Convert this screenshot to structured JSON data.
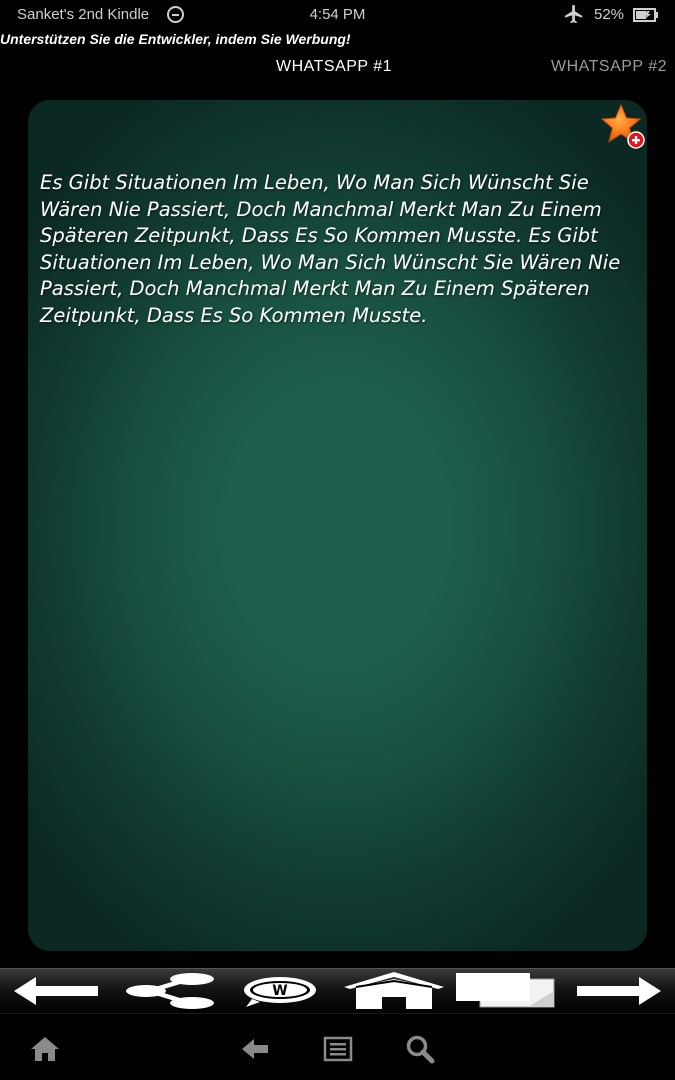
{
  "status_bar": {
    "device_name": "Sanket's 2nd Kindle",
    "time": "4:54 PM",
    "battery": "52%",
    "icons": [
      "do-not-disturb-icon",
      "airplane-icon",
      "battery-icon"
    ]
  },
  "ad_text": "Unterstützen Sie die Entwickler, indem Sie Werbung!",
  "tabs": [
    {
      "label": "WHATSAPP  #1",
      "active": true
    },
    {
      "label": "WHATSAPP  #2",
      "active": false
    }
  ],
  "quote": {
    "text": "Es Gibt Situationen Im Leben, Wo Man Sich Wünscht Sie Wären Nie Passiert, Doch Manchmal Merkt Man Zu Einem Späteren Zeitpunkt, Dass Es So Kommen Musste. Es Gibt Situationen Im Leben, Wo Man Sich Wünscht Sie Wären Nie Passiert, Doch Manchmal Merkt Man Zu Einem Späteren Zeitpunkt, Dass Es So Kommen Musste."
  },
  "card": {
    "favorite_icon": "star-add-icon",
    "colors": {
      "center": "#1d5e4e",
      "edge": "#0b2822",
      "star": "#ff7a1a",
      "badge": "#e0161b"
    }
  },
  "action_bar": {
    "icons": [
      "arrow-left-icon",
      "share-icon",
      "whatsapp-icon",
      "home-icon",
      "copy-icon",
      "arrow-right-icon"
    ]
  },
  "nav_bar": {
    "icons": [
      "home-icon",
      "back-icon",
      "menu-icon",
      "search-icon"
    ]
  }
}
